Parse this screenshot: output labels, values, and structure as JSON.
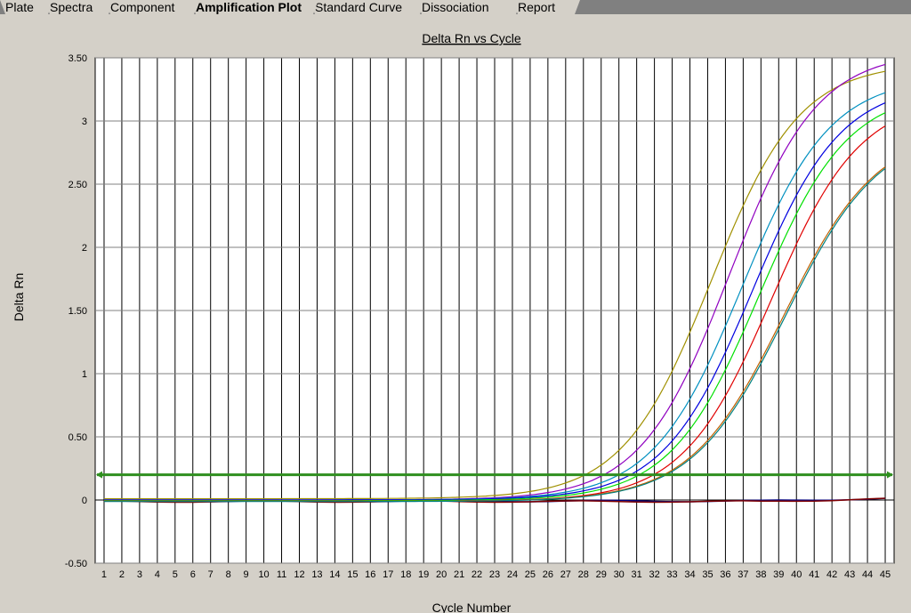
{
  "tabs": [
    {
      "label": "Plate",
      "active": false
    },
    {
      "label": "Spectra",
      "active": false
    },
    {
      "label": "Component",
      "active": false
    },
    {
      "label": "Amplification Plot",
      "active": true
    },
    {
      "label": "Standard Curve",
      "active": false
    },
    {
      "label": "Dissociation",
      "active": false
    },
    {
      "label": "Report",
      "active": false
    }
  ],
  "chart_data": {
    "type": "line",
    "title": "Delta Rn vs Cycle",
    "xlabel": "Cycle Number",
    "ylabel": "Delta Rn",
    "xlim": [
      0.5,
      45.5
    ],
    "ylim": [
      -0.5,
      3.5
    ],
    "x_ticks": [
      "1",
      "2",
      "3",
      "4",
      "5",
      "6",
      "7",
      "8",
      "9",
      "10",
      "11",
      "12",
      "13",
      "14",
      "15",
      "16",
      "17",
      "18",
      "19",
      "20",
      "21",
      "22",
      "23",
      "24",
      "25",
      "26",
      "27",
      "28",
      "29",
      "30",
      "31",
      "32",
      "33",
      "34",
      "35",
      "36",
      "37",
      "38",
      "39",
      "40",
      "41",
      "42",
      "43",
      "44",
      "45"
    ],
    "y_ticks": [
      {
        "value": -0.5,
        "label": "-0.50"
      },
      {
        "value": 0,
        "label": "0"
      },
      {
        "value": 0.5,
        "label": "0.50"
      },
      {
        "value": 1,
        "label": "1"
      },
      {
        "value": 1.5,
        "label": "1.50"
      },
      {
        "value": 2,
        "label": "2"
      },
      {
        "value": 2.5,
        "label": "2.50"
      },
      {
        "value": 3,
        "label": "3"
      },
      {
        "value": 3.5,
        "label": "3.50"
      }
    ],
    "grid": true,
    "threshold": {
      "value": 0.2,
      "color": "#2f8f1f"
    },
    "series": [
      {
        "color": "#a09000",
        "midpoint": 35.2,
        "slope": 0.4,
        "plateau": 3.45,
        "baseline_offset": 0.01
      },
      {
        "color": "#9000c0",
        "midpoint": 36.2,
        "slope": 0.4,
        "plateau": 3.55,
        "baseline_offset": 0.0
      },
      {
        "color": "#0090c0",
        "midpoint": 36.9,
        "slope": 0.4,
        "plateau": 3.35,
        "baseline_offset": 0.0
      },
      {
        "color": "#0000e0",
        "midpoint": 37.5,
        "slope": 0.4,
        "plateau": 3.3,
        "baseline_offset": 0.0
      },
      {
        "color": "#00e000",
        "midpoint": 37.9,
        "slope": 0.4,
        "plateau": 3.25,
        "baseline_offset": -0.005
      },
      {
        "color": "#e00000",
        "midpoint": 38.6,
        "slope": 0.4,
        "plateau": 3.2,
        "baseline_offset": -0.01
      },
      {
        "color": "#c06000",
        "midpoint": 39.3,
        "slope": 0.38,
        "plateau": 2.95,
        "baseline_offset": -0.01
      },
      {
        "color": "#008080",
        "midpoint": 39.4,
        "slope": 0.38,
        "plateau": 2.95,
        "baseline_offset": -0.012
      }
    ],
    "flat_series": [
      {
        "color": "#000080",
        "values_note": "near zero"
      },
      {
        "color": "#800000",
        "values_note": "near zero"
      }
    ]
  }
}
